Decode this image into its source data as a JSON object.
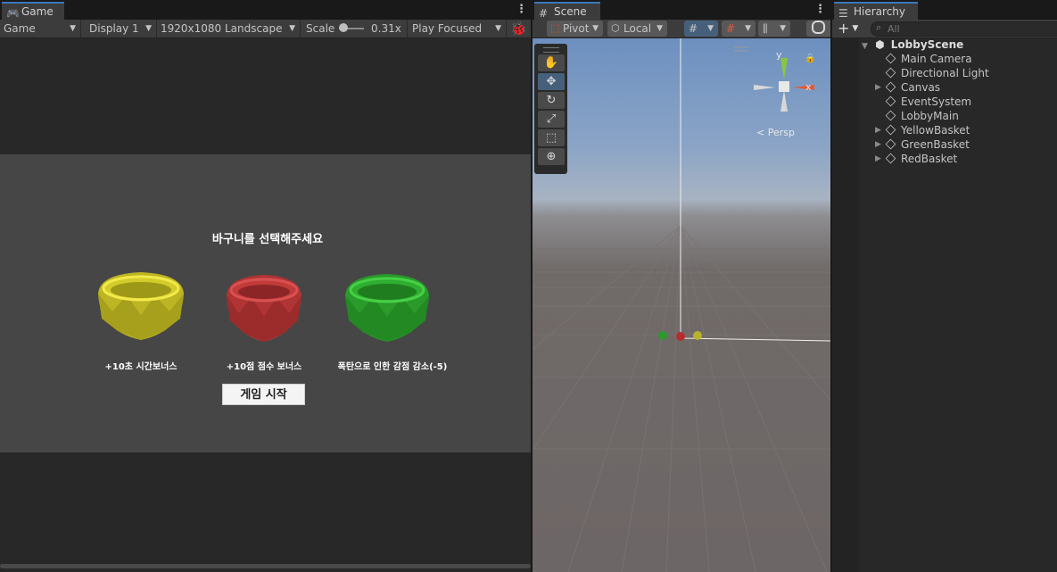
{
  "game": {
    "tab_label": "Game",
    "toolbar": {
      "view_mode": "Game",
      "display": "Display 1",
      "resolution": "1920x1080 Landscape",
      "scale_label": "Scale",
      "scale_value": "0.31x",
      "play_mode": "Play Focused"
    },
    "canvas": {
      "title": "바구니를 선택해주세요",
      "baskets": [
        {
          "color": "#d4cc2a",
          "label": "+10초 시간보너스"
        },
        {
          "color": "#c23a3a",
          "label": "+10점 점수 보너스"
        },
        {
          "color": "#2fae2f",
          "label": "폭탄으로 인한 감점 감소(-5)"
        }
      ],
      "start_button": "게임 시작"
    }
  },
  "scene": {
    "tab_label": "Scene",
    "toolbar": {
      "pivot": "Pivot",
      "space": "Local"
    },
    "gizmo": {
      "y_label": "y",
      "x_label": "x",
      "projection": "< Persp"
    },
    "tools": [
      "hand-tool",
      "move-tool",
      "rotate-tool",
      "scale-tool",
      "rect-tool",
      "transform-tool"
    ]
  },
  "hierarchy": {
    "tab_label": "Hierarchy",
    "search_placeholder": "All",
    "scene_name": "LobbyScene",
    "items": [
      {
        "label": "Main Camera",
        "expandable": false
      },
      {
        "label": "Directional Light",
        "expandable": false
      },
      {
        "label": "Canvas",
        "expandable": true
      },
      {
        "label": "EventSystem",
        "expandable": false
      },
      {
        "label": "LobbyMain",
        "expandable": false
      },
      {
        "label": "YellowBasket",
        "expandable": true
      },
      {
        "label": "GreenBasket",
        "expandable": true
      },
      {
        "label": "RedBasket",
        "expandable": true
      }
    ]
  },
  "colors": {
    "accent": "#3a79bb",
    "panel_bg": "#282828",
    "toolbar_bg": "#3c3c3c",
    "game_canvas_bg": "#464646"
  }
}
